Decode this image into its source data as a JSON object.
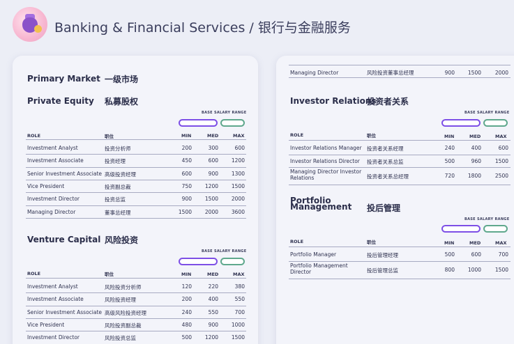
{
  "header": {
    "title": "Banking & Financial Services / 银行与金融服务",
    "logo_icon": "money-bag-icon"
  },
  "colors": {
    "purple_pill": "#7d4fe6",
    "green_pill": "#5fa88d"
  },
  "left": {
    "primary_market_en": "Primary Market",
    "primary_market_zh": "一级市场",
    "private_equity": {
      "title_en": "Private Equity",
      "title_zh": "私募股权",
      "range_label": "BASE SALARY RANGE",
      "headers": {
        "role": "ROLE",
        "zh": "职位",
        "min": "MIN",
        "med": "MED",
        "max": "MAX"
      },
      "rows": [
        {
          "role": "Investment Analyst",
          "zh": "投资分析师",
          "min": "200",
          "med": "300",
          "max": "600"
        },
        {
          "role": "Investment Associate",
          "zh": "投资经理",
          "min": "450",
          "med": "600",
          "max": "1200"
        },
        {
          "role": "Senior Investment Associate",
          "zh": "高级投资经理",
          "min": "600",
          "med": "900",
          "max": "1300"
        },
        {
          "role": "Vice President",
          "zh": "投资副总裁",
          "min": "750",
          "med": "1200",
          "max": "1500"
        },
        {
          "role": "Investment Director",
          "zh": "投资总监",
          "min": "900",
          "med": "1500",
          "max": "2000"
        },
        {
          "role": "Managing Director",
          "zh": "董事总经理",
          "min": "1500",
          "med": "2000",
          "max": "3600"
        }
      ]
    },
    "venture_capital": {
      "title_en": "Venture Capital",
      "title_zh": "风险投资",
      "range_label": "BASE SALARY RANGE",
      "headers": {
        "role": "ROLE",
        "zh": "职位",
        "min": "MIN",
        "med": "MED",
        "max": "MAX"
      },
      "rows": [
        {
          "role": "Investment Analyst",
          "zh": "风险投资分析师",
          "min": "120",
          "med": "220",
          "max": "380"
        },
        {
          "role": "Investment Associate",
          "zh": "风险投资经理",
          "min": "200",
          "med": "400",
          "max": "550"
        },
        {
          "role": "Senior Investment Associate",
          "zh": "高级风险投资经理",
          "min": "240",
          "med": "550",
          "max": "700"
        },
        {
          "role": "Vice President",
          "zh": "风险投资副总裁",
          "min": "480",
          "med": "900",
          "max": "1000"
        },
        {
          "role": "Investment Director",
          "zh": "风险投资总监",
          "min": "500",
          "med": "1200",
          "max": "1500"
        }
      ]
    }
  },
  "right": {
    "top_row": {
      "role": "Managing Director",
      "zh": "风险投资董事总经理",
      "min": "900",
      "med": "1500",
      "max": "2000"
    },
    "investor_relations": {
      "title_en": "Investor Relations",
      "title_zh": "投资者关系",
      "range_label": "BASE SALARY RANGE",
      "headers": {
        "role": "ROLE",
        "zh": "职位",
        "min": "MIN",
        "med": "MED",
        "max": "MAX"
      },
      "rows": [
        {
          "role": "Investor Relations Manager",
          "zh": "投资者关系经理",
          "min": "240",
          "med": "400",
          "max": "600"
        },
        {
          "role": "Investor Relations Director",
          "zh": "投资者关系总监",
          "min": "500",
          "med": "960",
          "max": "1500"
        },
        {
          "role": "Managing Director Investor Relations",
          "zh": "投资者关系总经理",
          "min": "720",
          "med": "1800",
          "max": "2500"
        }
      ]
    },
    "portfolio_management": {
      "title_en": "Portfolio Management",
      "title_zh": "投后管理",
      "range_label": "BASE SALARY RANGE",
      "headers": {
        "role": "ROLE",
        "zh": "职位",
        "min": "MIN",
        "med": "MED",
        "max": "MAX"
      },
      "rows": [
        {
          "role": "Portfolio Manager",
          "zh": "投后管理经理",
          "min": "500",
          "med": "600",
          "max": "700"
        },
        {
          "role": "Portfolio Management Director",
          "zh": "投后管理总监",
          "min": "800",
          "med": "1000",
          "max": "1500"
        }
      ]
    }
  }
}
